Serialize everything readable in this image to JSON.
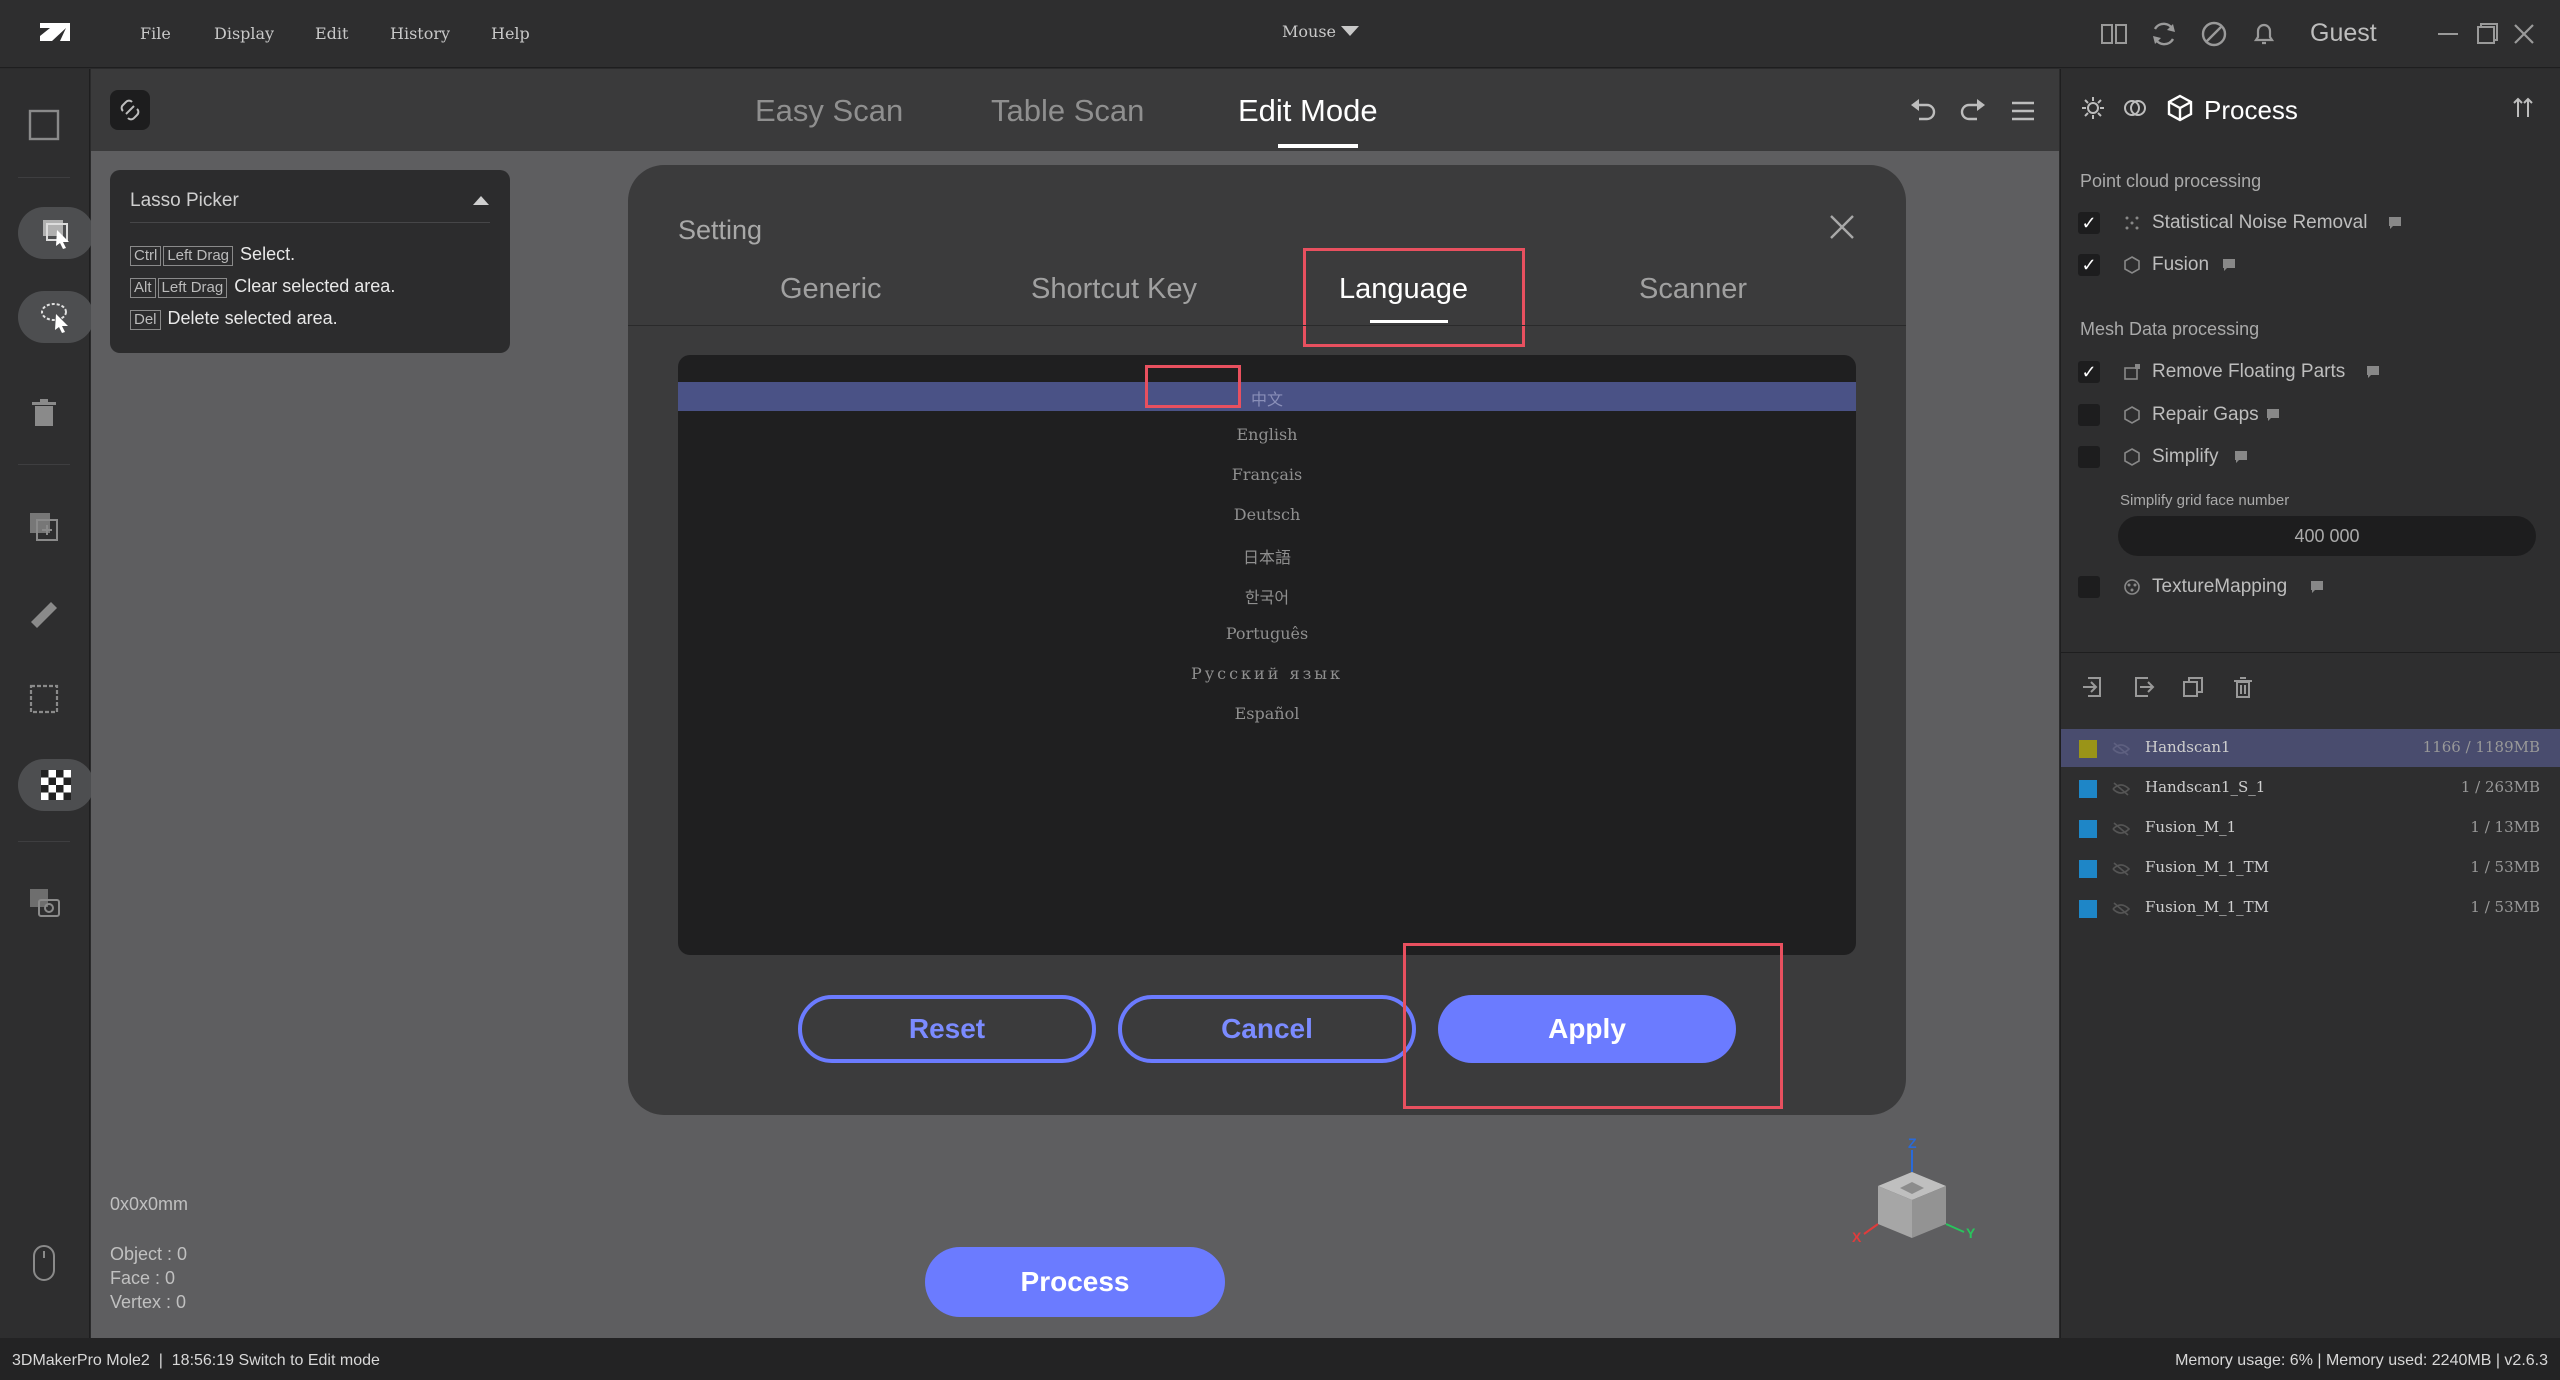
{
  "menu": {
    "items": [
      "File",
      "Display",
      "Edit",
      "History",
      "Help"
    ],
    "mode_select": "Mouse",
    "user": "Guest"
  },
  "mode_tabs": [
    "Easy Scan",
    "Table Scan",
    "Edit Mode"
  ],
  "active_mode": "Edit Mode",
  "lasso": {
    "title": "Lasso Picker",
    "rows": [
      {
        "keys": [
          "Ctrl",
          "Left Drag"
        ],
        "text": "Select."
      },
      {
        "keys": [
          "Alt",
          "Left Drag"
        ],
        "text": "Clear selected area."
      },
      {
        "keys": [
          "Del"
        ],
        "text": "Delete selected area."
      }
    ]
  },
  "dialog": {
    "title": "Setting",
    "tabs": [
      "Generic",
      "Shortcut Key",
      "Language",
      "Scanner"
    ],
    "active_tab": "Language",
    "languages": [
      "中文",
      "English",
      "Français",
      "Deutsch",
      "日本語",
      "한국어",
      "Português",
      "Русский язык",
      "Español"
    ],
    "selected_language": "中文",
    "buttons": {
      "reset": "Reset",
      "cancel": "Cancel",
      "apply": "Apply"
    }
  },
  "info": {
    "dimensions": "0x0x0mm",
    "object": "Object : 0",
    "face": "Face : 0",
    "vertex": "Vertex : 0"
  },
  "process_button": "Process",
  "axis": {
    "z": "Z",
    "y": "Y",
    "x": "X"
  },
  "right_panel": {
    "title": "Process",
    "point_cloud_section": "Point cloud processing",
    "point_cloud_items": [
      {
        "label": "Statistical Noise Removal",
        "checked": true
      },
      {
        "label": "Fusion",
        "checked": true
      }
    ],
    "mesh_section": "Mesh Data processing",
    "mesh_items": [
      {
        "label": "Remove Floating Parts",
        "checked": true
      },
      {
        "label": "Repair Gaps",
        "checked": false
      },
      {
        "label": "Simplify",
        "checked": false
      }
    ],
    "simplify_label": "Simplify grid face number",
    "simplify_value": "400 000",
    "texture_item": {
      "label": "TextureMapping",
      "checked": false
    },
    "models": [
      {
        "name": "Handscan1",
        "stats": "1166 / 1189MB",
        "color": "#9a9418",
        "selected": true
      },
      {
        "name": "Handscan1_S_1",
        "stats": "1 / 263MB",
        "color": "#1e86c7",
        "selected": false
      },
      {
        "name": "Fusion_M_1",
        "stats": "1 / 13MB",
        "color": "#1e86c7",
        "selected": false
      },
      {
        "name": "Fusion_M_1_TM",
        "stats": "1 / 53MB",
        "color": "#1e86c7",
        "selected": false
      },
      {
        "name": "Fusion_M_1_TM",
        "stats": "1 / 53MB",
        "color": "#1e86c7",
        "selected": false
      }
    ]
  },
  "status": {
    "left": "3DMakerPro Mole2  |  18:56:19 Switch to Edit mode",
    "right": "Memory usage: 6% | Memory used: 2240MB | v2.6.3"
  }
}
